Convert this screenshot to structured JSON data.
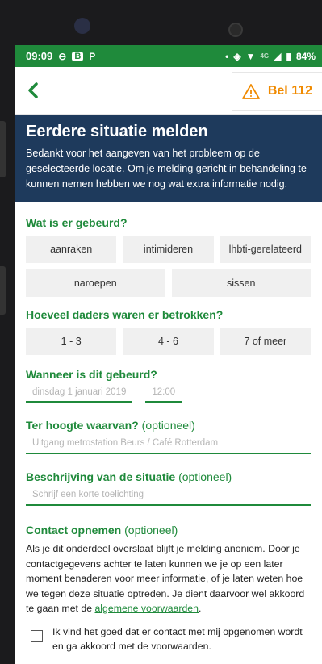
{
  "status_bar": {
    "time": "09:09",
    "battery": "84%",
    "network": "4G"
  },
  "header": {
    "back_icon": "chevron-left-icon",
    "emergency_label": "Bel 112",
    "warning_icon": "warning-triangle-icon"
  },
  "banner": {
    "title": "Eerdere situatie melden",
    "text": "Bedankt voor het aangeven van het probleem op de geselecteerde locatie. Om je melding gericht in behandeling te kunnen nemen hebben we nog wat extra informatie nodig."
  },
  "what": {
    "question": "Wat is er gebeurd?",
    "options": [
      "aanraken",
      "intimideren",
      "lhbti-gerelateerd",
      "naroepen",
      "sissen"
    ]
  },
  "perpetrators": {
    "question": "Hoeveel daders waren er betrokken?",
    "options": [
      "1 - 3",
      "4 - 6",
      "7 of meer"
    ]
  },
  "when": {
    "question": "Wanneer is dit gebeurd?",
    "date_placeholder": "dinsdag 1 januari 2019",
    "time_placeholder": "12:00"
  },
  "location": {
    "question": "Ter hoogte waarvan?",
    "optional": "(optioneel)",
    "placeholder": "Uitgang metrostation Beurs / Café Rotterdam"
  },
  "description": {
    "question": "Beschrijving van de situatie",
    "optional": "(optioneel)",
    "placeholder": "Schrijf een korte toelichting"
  },
  "contact": {
    "question": "Contact opnemen",
    "optional": "(optioneel)",
    "text_before": "Als je dit onderdeel overslaat blijft je melding anoniem. Door je contactgegevens achter te laten kunnen we je op een later moment benaderen voor meer informatie, of je laten weten hoe we tegen deze situatie optreden. Je dient daarvoor wel akkoord te gaan met de ",
    "link": "algemene voorwaarden",
    "text_after": ".",
    "checkbox_label": "Ik vind het goed dat er contact met mij opgenomen wordt en ga akkoord met de voorwaarden."
  },
  "colors": {
    "status_green": "#1f8a3b",
    "banner_navy": "#1e3a5c",
    "accent_orange": "#f08a00"
  }
}
